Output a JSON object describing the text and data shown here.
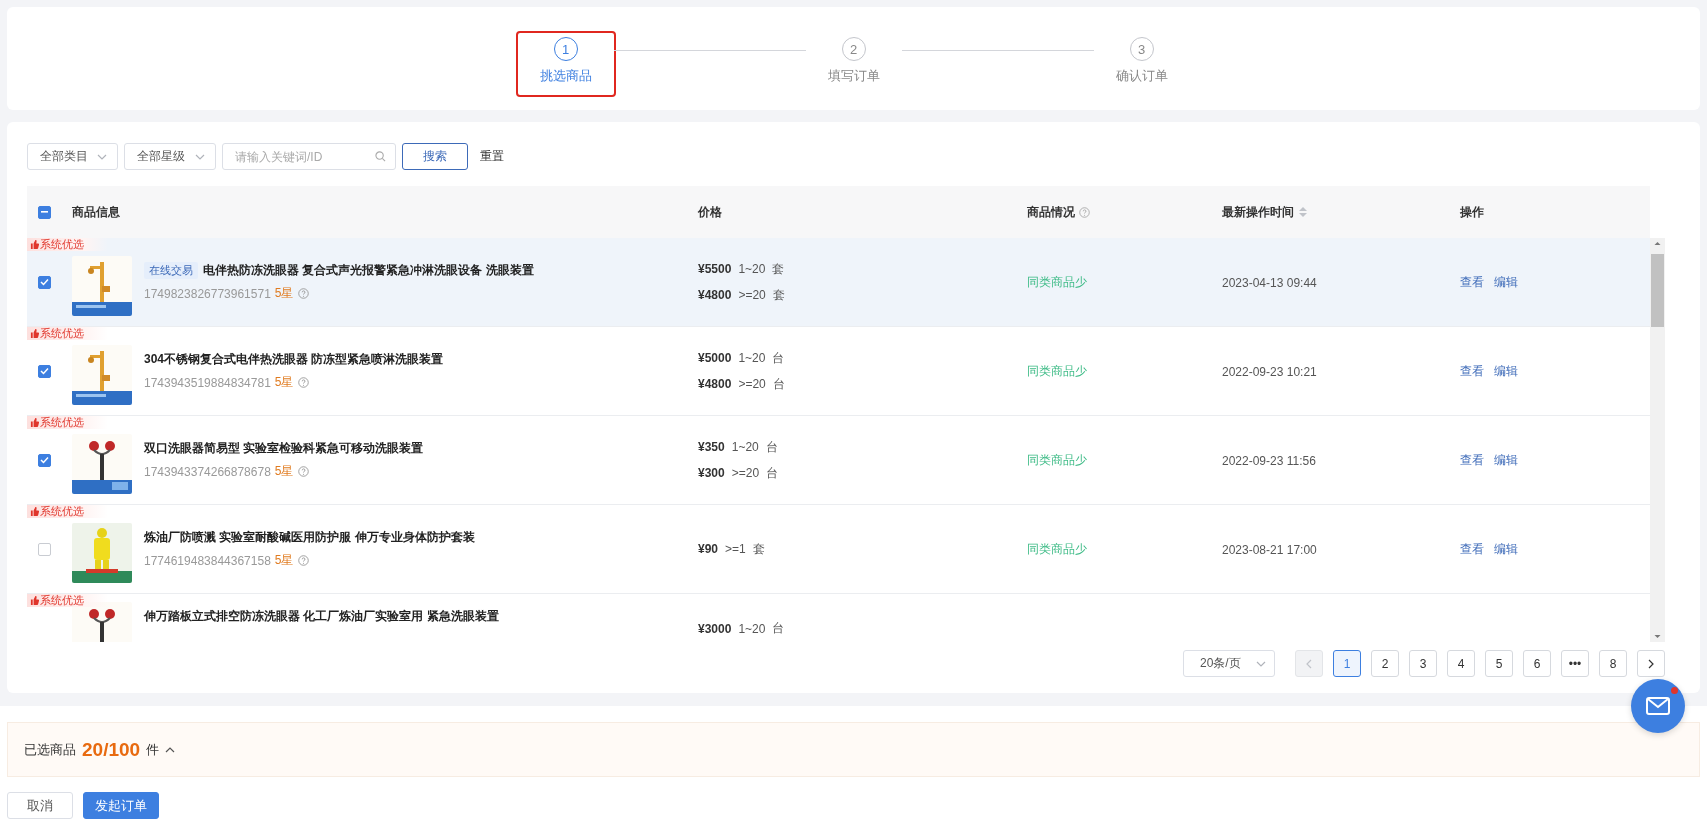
{
  "steps": [
    {
      "number": "1",
      "label": "挑选商品",
      "selected": true
    },
    {
      "number": "2",
      "label": "填写订单",
      "selected": false
    },
    {
      "number": "3",
      "label": "确认订单",
      "selected": false
    }
  ],
  "filters": {
    "category": "全部类目",
    "rating": "全部星级",
    "search": {
      "placeholder": "请输入关键词/ID"
    },
    "search_button": "搜索",
    "reset_button": "重置"
  },
  "table": {
    "select_all": {
      "indeterminate": true
    },
    "columns": [
      {
        "label": "商品信息",
        "kind": "plain"
      },
      {
        "label": "价格",
        "kind": "plain"
      },
      {
        "label": "商品情况",
        "kind": "help"
      },
      {
        "label": "最新操作时间",
        "kind": "sort"
      },
      {
        "label": "操作",
        "kind": "plain"
      }
    ],
    "rows": [
      {
        "badge": "系统优选",
        "checked": true,
        "selected": true,
        "tag": "在线交易",
        "title": "电伴热防冻洗眼器 复合式声光报警紧急冲淋洗眼设备 洗眼装置",
        "id": "1749823826773961571",
        "rating": "5星",
        "prices": [
          {
            "price": "¥5500",
            "range": "1~20",
            "unit": "套"
          },
          {
            "price": "¥4800",
            "range": ">=20",
            "unit": "套"
          }
        ],
        "status": "同类商品少",
        "time": "2023-04-13 09:44",
        "actions": [
          "查看",
          "编辑"
        ]
      },
      {
        "badge": "系统优选",
        "checked": true,
        "selected": false,
        "title": "304不锈钢复合式电伴热洗眼器 防冻型紧急喷淋洗眼装置",
        "id": "1743943519884834781",
        "rating": "5星",
        "prices": [
          {
            "price": "¥5000",
            "range": "1~20",
            "unit": "台"
          },
          {
            "price": "¥4800",
            "range": ">=20",
            "unit": "台"
          }
        ],
        "status": "同类商品少",
        "time": "2022-09-23 10:21",
        "actions": [
          "查看",
          "编辑"
        ]
      },
      {
        "badge": "系统优选",
        "checked": true,
        "selected": false,
        "title": "双口洗眼器简易型 实验室检验科紧急可移动洗眼装置",
        "id": "1743943374266878678",
        "rating": "5星",
        "prices": [
          {
            "price": "¥350",
            "range": "1~20",
            "unit": "台"
          },
          {
            "price": "¥300",
            "range": ">=20",
            "unit": "台"
          }
        ],
        "status": "同类商品少",
        "time": "2022-09-23 11:56",
        "actions": [
          "查看",
          "编辑"
        ]
      },
      {
        "badge": "系统优选",
        "checked": false,
        "selected": false,
        "title": "炼油厂防喷溅 实验室耐酸碱医用防护服 伸万专业身体防护套装",
        "id": "1774619483844367158",
        "rating": "5星",
        "prices": [
          {
            "price": "¥90",
            "range": ">=1",
            "unit": "套"
          }
        ],
        "status": "同类商品少",
        "time": "2023-08-21 17:00",
        "actions": [
          "查看",
          "编辑"
        ]
      },
      {
        "badge": "系统优选",
        "selected": false,
        "title": "伸万踏板立式排空防冻洗眼器 化工厂炼油厂实验室用 紧急洗眼装置",
        "prices": [
          {
            "price": "¥3000",
            "range": "1~20",
            "unit": "台"
          }
        ]
      }
    ]
  },
  "pagination": {
    "page_size": "20条/页",
    "prev_disabled": true,
    "pages": [
      {
        "label": "1",
        "selected": true
      },
      {
        "label": "2",
        "selected": false
      },
      {
        "label": "3",
        "selected": false
      },
      {
        "label": "4",
        "selected": false
      },
      {
        "label": "5",
        "selected": false
      },
      {
        "label": "6",
        "selected": false
      },
      {
        "label": "•••",
        "selected": false
      },
      {
        "label": "8",
        "selected": false
      }
    ]
  },
  "selection": {
    "label": "已选商品",
    "count": "20/100",
    "unit": "件"
  },
  "buttons": [
    {
      "label": "取消",
      "kind": "secondary"
    },
    {
      "label": "发起订单",
      "kind": "primary"
    }
  ]
}
